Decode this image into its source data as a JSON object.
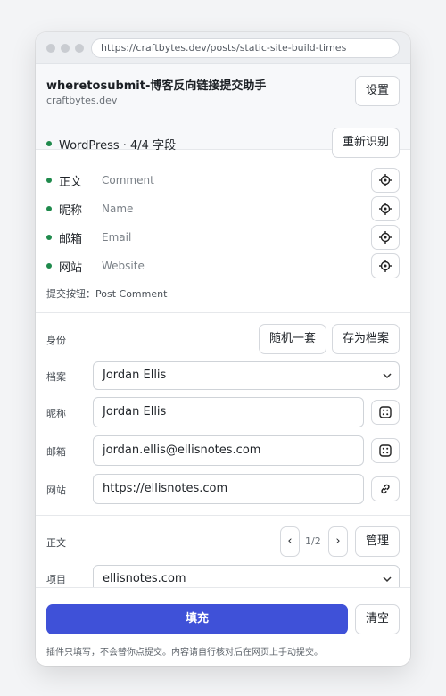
{
  "browser": {
    "url": "https://craftbytes.dev/posts/static-site-build-times"
  },
  "header": {
    "title": "wheretosubmit-博客反向链接提交助手",
    "domain": "craftbytes.dev",
    "settings_label": "设置"
  },
  "detection": {
    "summary": "WordPress · 4/4 字段",
    "redetect_label": "重新识别",
    "fields": [
      {
        "name": "正文",
        "target": "Comment"
      },
      {
        "name": "昵称",
        "target": "Name"
      },
      {
        "name": "邮箱",
        "target": "Email"
      },
      {
        "name": "网站",
        "target": "Website"
      }
    ],
    "submit_info": "提交按钮：Post Comment",
    "status_color": "#1f8a4c"
  },
  "identity": {
    "section_label": "身份",
    "random_label": "随机一套",
    "save_profile_label": "存为档案",
    "profile_label": "档案",
    "profile_value": "Jordan Ellis",
    "nickname_label": "昵称",
    "nickname_value": "Jordan Ellis",
    "email_label": "邮箱",
    "email_value": "jordan.ellis@ellisnotes.com",
    "website_label": "网站",
    "website_value": "https://ellisnotes.com"
  },
  "content": {
    "section_label": "正文",
    "pager": "1/2",
    "manage_label": "管理",
    "project_label": "项目",
    "project_value": "ellisnotes.com"
  },
  "footer": {
    "fill_label": "填充",
    "clear_label": "清空",
    "note": "插件只填写，不会替你点提交。内容请自行核对后在网页上手动提交。",
    "accent": "#3f51d8"
  }
}
